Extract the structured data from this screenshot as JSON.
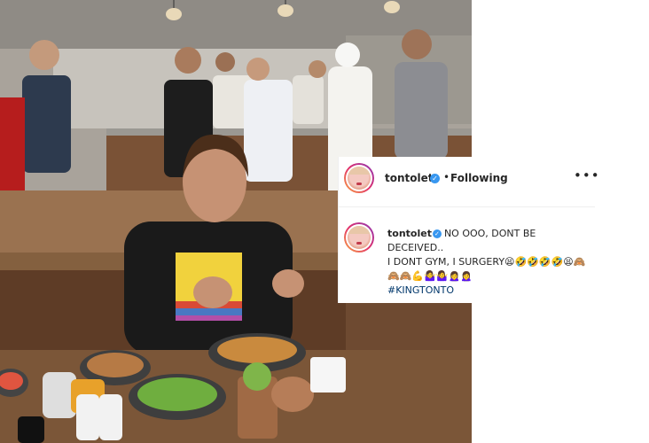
{
  "post": {
    "header": {
      "username": "tontolet",
      "separator": "•",
      "follow_status": "Following",
      "more_glyph": "•••"
    },
    "caption": {
      "username": "tontolet",
      "line1": "NO OOO, DONT BE",
      "line2": "DECEIVED..",
      "line3": "I DONT GYM, I SURGERY😫🤣🤣🤣🤣😫🙈",
      "line4": "🙈🙈💪🤷‍♀️🤷‍♀️🙍‍♀️🙍‍♀️",
      "hashtag": "#KINGTONTO"
    }
  },
  "colors": {
    "verified_badge": "#3897f0",
    "hashtag": "#00376b",
    "text": "#262626",
    "divider": "#efefef"
  },
  "icons": {
    "verified": "verified-badge-icon",
    "more": "more-options-icon"
  }
}
